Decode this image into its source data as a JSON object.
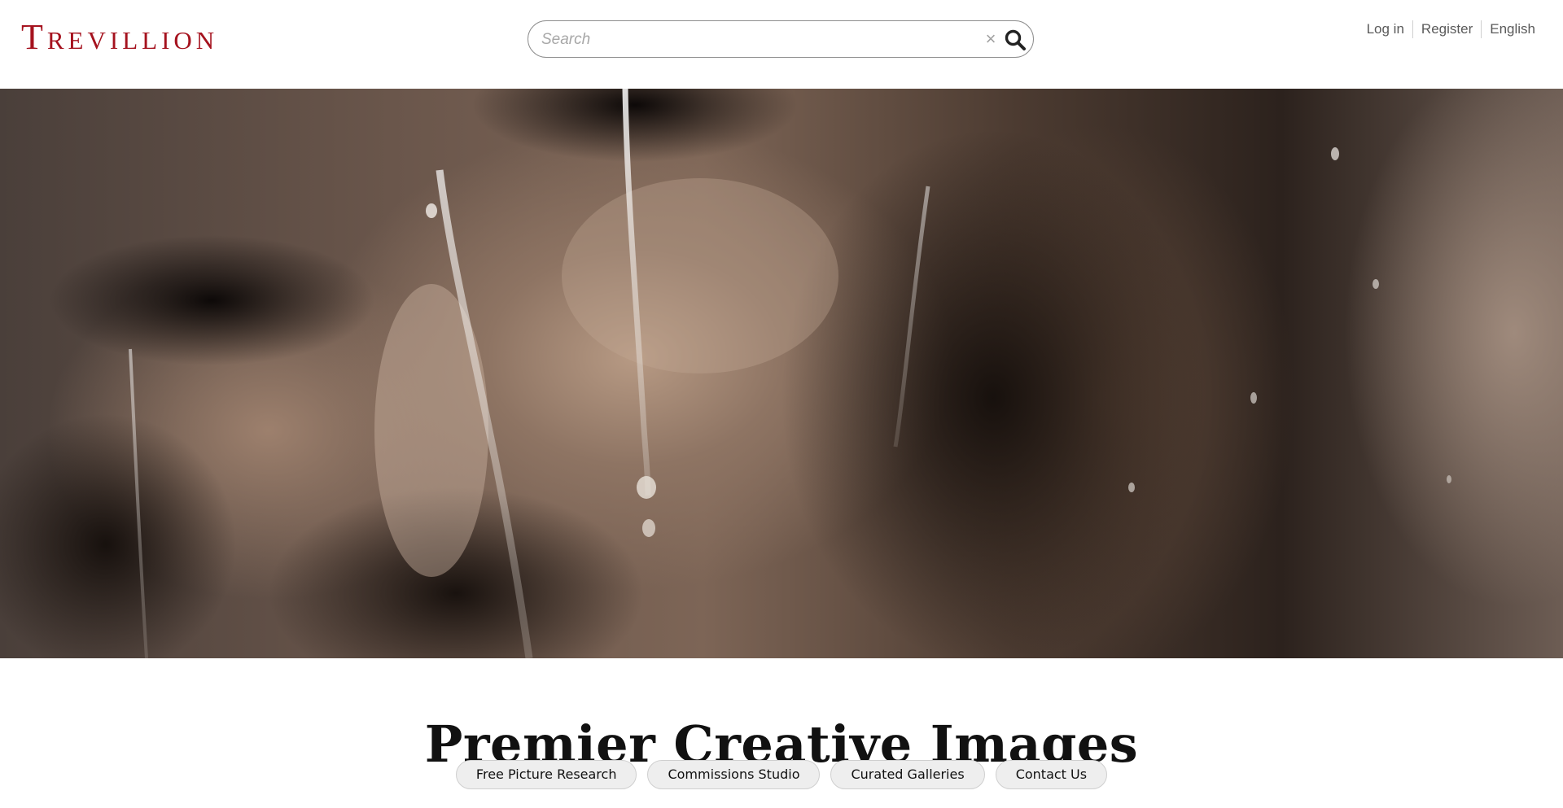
{
  "header": {
    "logo_text": "Trevillion",
    "search": {
      "placeholder": "Search",
      "value": ""
    },
    "nav": [
      {
        "label": "Log in"
      },
      {
        "label": "Register"
      },
      {
        "label": "English"
      }
    ]
  },
  "hero": {
    "image": "close-up of wet man's face with water streaming down"
  },
  "main": {
    "headline": "Premier Creative Images",
    "buttons": [
      {
        "label": "Free Picture Research"
      },
      {
        "label": "Commissions Studio"
      },
      {
        "label": "Curated Galleries"
      },
      {
        "label": "Contact Us"
      }
    ]
  },
  "colors": {
    "brand": "#a5121e",
    "pill_bg": "#eeeeee",
    "text": "#111111"
  }
}
